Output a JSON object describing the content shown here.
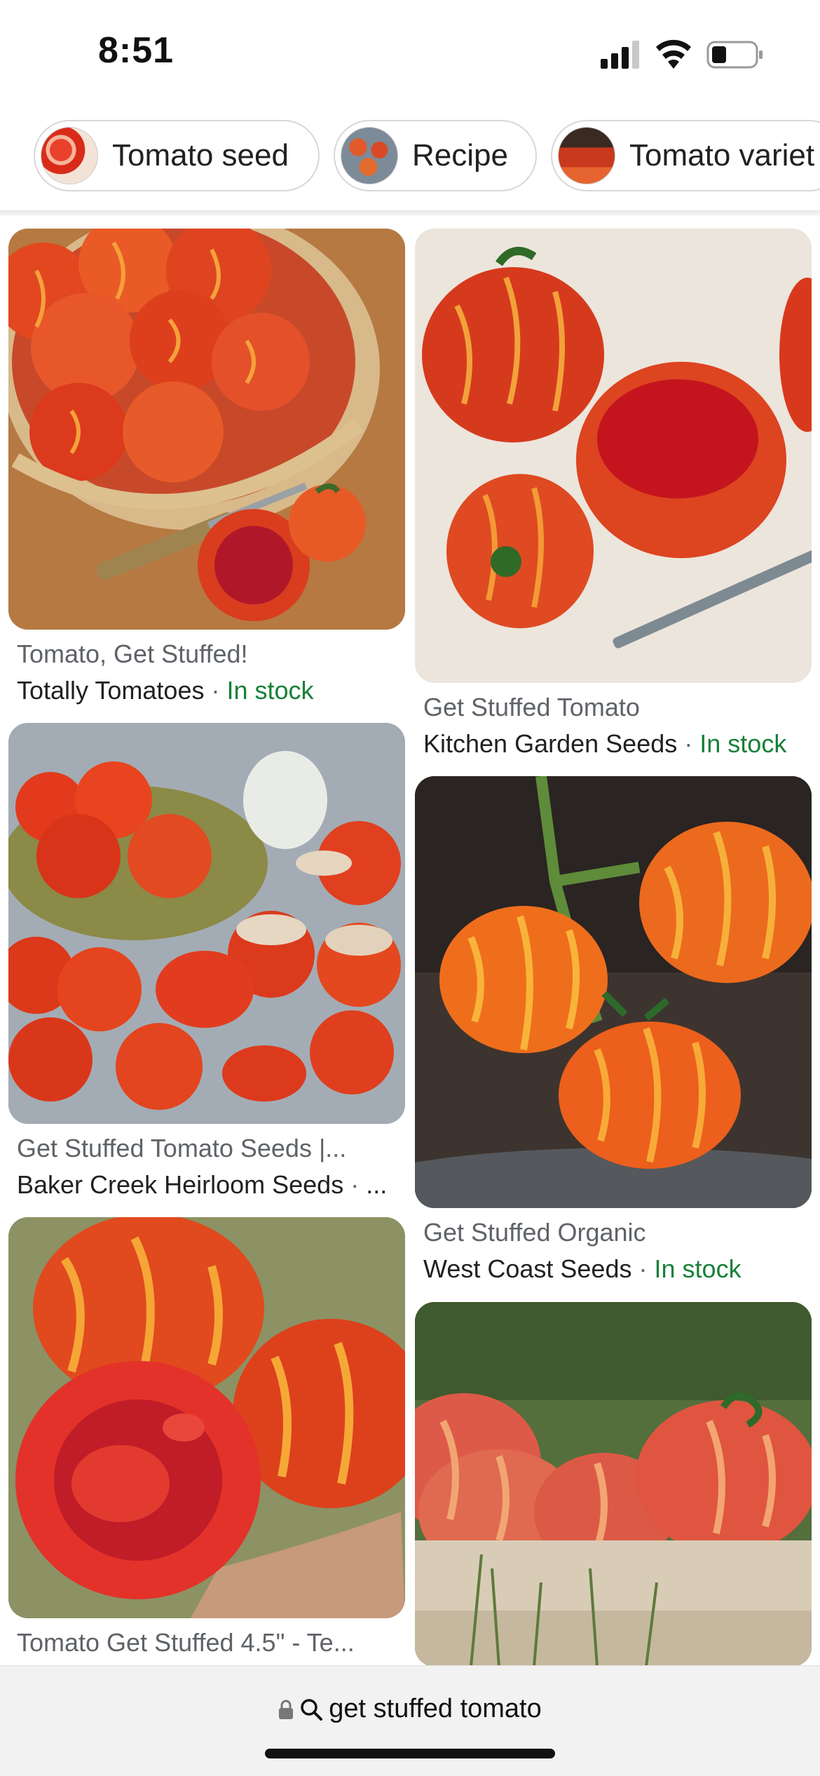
{
  "status_bar": {
    "time": "8:51"
  },
  "chips": [
    {
      "label": "Tomato seed",
      "thumb_icon": "tomato-seed-thumbnail"
    },
    {
      "label": "Recipe",
      "thumb_icon": "stuffed-tomato-recipe-thumbnail"
    },
    {
      "label": "Tomato variet",
      "thumb_icon": "tomato-variety-thumbnail"
    }
  ],
  "results": [
    {
      "title": "Tomato, Get Stuffed!",
      "source": "Totally Tomatoes",
      "separator": "·",
      "stock": "In stock"
    },
    {
      "title": "Get Stuffed Tomato",
      "source": "Kitchen Garden Seeds",
      "separator": "·",
      "stock": "In stock"
    },
    {
      "title": "Get Stuffed Tomato Seeds |...",
      "source": "Baker Creek Heirloom Seeds",
      "separator": "·",
      "more": "..."
    },
    {
      "title": "Get Stuffed Organic",
      "source": "West Coast Seeds",
      "separator": "·",
      "stock": "In stock"
    },
    {
      "title": "Tomato Get Stuffed 4.5\" - Te..."
    }
  ],
  "bottom_bar": {
    "query": "get stuffed tomato"
  },
  "colors": {
    "in_stock": "#188038",
    "title_gray": "#5f6368",
    "tomato_red": "#d9301c",
    "tomato_orange": "#f07a1e"
  }
}
